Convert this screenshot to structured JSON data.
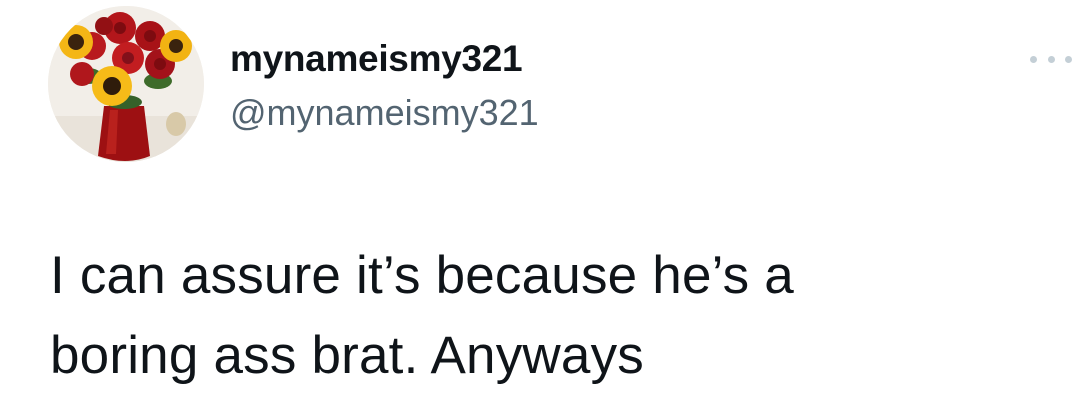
{
  "user": {
    "display_name": "mynameismy321",
    "handle": "@mynameismy321",
    "avatar_icon": "sunflower-rose-bouquet-avatar"
  },
  "menu": {
    "more_icon": "more-horizontal-icon"
  },
  "tweet": {
    "lines": [
      "I can assure it’s because he’s a",
      "boring ass brat. Anyways"
    ]
  },
  "colors": {
    "text": "#0f1419",
    "secondary": "#536471",
    "more_dots": "#c4cfd6"
  }
}
